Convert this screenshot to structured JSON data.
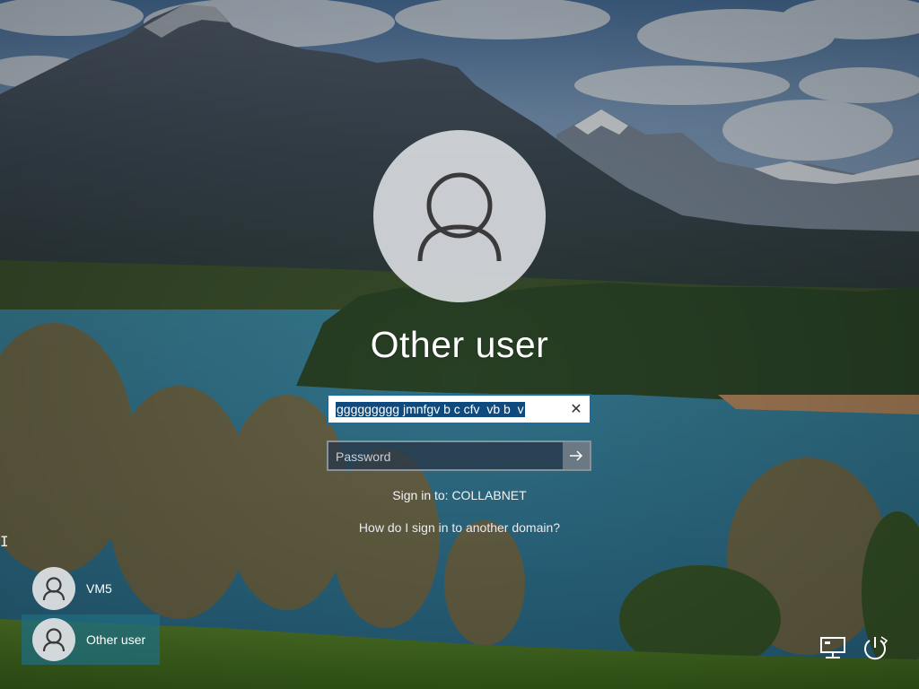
{
  "screen": "Windows sign-in",
  "selected_user": {
    "name": "Other user"
  },
  "username_field": {
    "value": "ggggggggg jmnfgv b c cfv  vb b  v",
    "clear_icon": "close-icon"
  },
  "password_field": {
    "placeholder": "Password",
    "submit_icon": "arrow-right-icon"
  },
  "sign_in_to": "Sign in to: COLLABNET",
  "help_link": "How do I sign in to another domain?",
  "user_list": [
    {
      "name": "VM5",
      "selected": false
    },
    {
      "name": "Other user",
      "selected": true
    }
  ],
  "corner_icons": [
    "network-icon",
    "power-icon"
  ],
  "colors": {
    "selection": "#0f4a7e",
    "field_border": "#1a6d9e",
    "selected_tile": "#1e6e82"
  }
}
